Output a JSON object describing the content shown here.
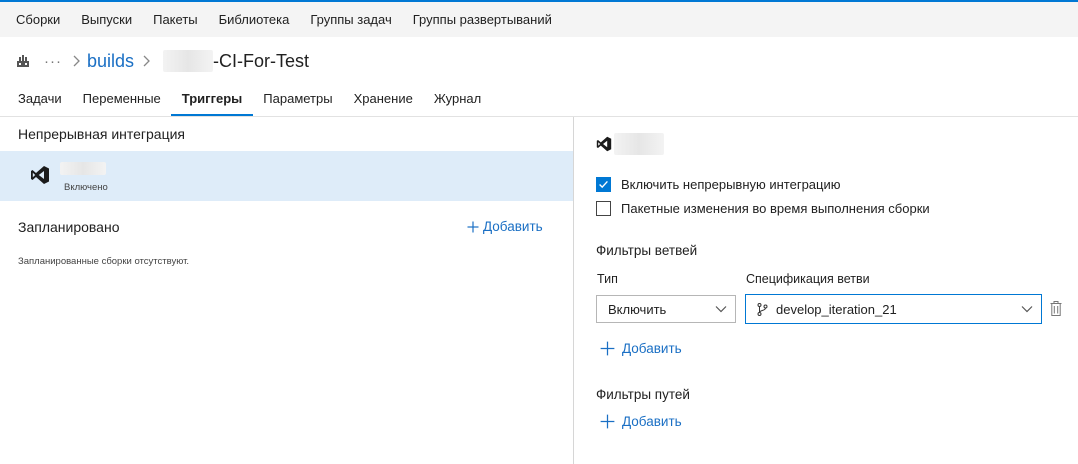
{
  "topnav": {
    "items": [
      "Сборки",
      "Выпуски",
      "Пакеты",
      "Библиотека",
      "Группы задач",
      "Группы развертываний"
    ]
  },
  "breadcrumb": {
    "more": "···",
    "builds_link": "builds",
    "title": "-CI-For-Test"
  },
  "tabs": [
    {
      "label": "Задачи",
      "active": false
    },
    {
      "label": "Переменные",
      "active": false
    },
    {
      "label": "Триггеры",
      "active": true
    },
    {
      "label": "Параметры",
      "active": false
    },
    {
      "label": "Хранение",
      "active": false
    },
    {
      "label": "Журнал",
      "active": false
    }
  ],
  "left": {
    "ci_title": "Непрерывная интеграция",
    "repo_status": "Включено",
    "scheduled_title": "Запланировано",
    "add_label": "Добавить",
    "scheduled_empty": "Запланированные сборки отсутствуют."
  },
  "right": {
    "enable_ci_label": "Включить непрерывную интеграцию",
    "enable_ci_checked": true,
    "batch_label": "Пакетные изменения во время выполнения сборки",
    "batch_checked": false,
    "branch_filters_title": "Фильтры ветвей",
    "type_label": "Тип",
    "spec_label": "Спецификация ветви",
    "type_value": "Включить",
    "branch_value": "develop_iteration_21",
    "add_label": "Добавить",
    "path_filters_title": "Фильтры путей"
  },
  "colors": {
    "accent": "#0078d4",
    "selected_row": "#deecf9",
    "link": "#1a6fc4"
  },
  "icons": [
    "pipeline-icon",
    "chevron-right-icon",
    "visual-studio-icon",
    "plus-icon",
    "checkmark-icon",
    "branch-icon",
    "chevron-down-icon",
    "trash-icon"
  ]
}
